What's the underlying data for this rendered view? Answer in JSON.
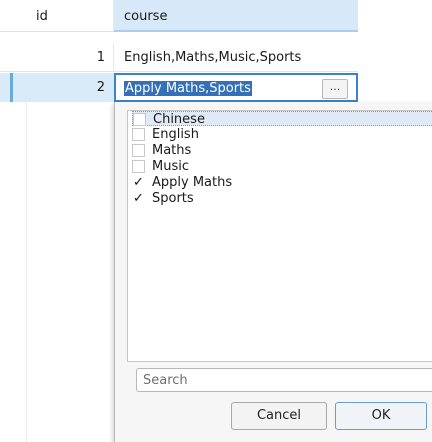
{
  "table": {
    "columns": [
      "id",
      "course"
    ],
    "rows": [
      {
        "id": "1",
        "course": "English,Maths,Music,Sports"
      },
      {
        "id": "2",
        "course": "Apply Maths,Sports"
      }
    ]
  },
  "editor": {
    "ellipsis_label": "..."
  },
  "picker": {
    "items": [
      {
        "label": "Chinese",
        "checked": false
      },
      {
        "label": "English",
        "checked": false
      },
      {
        "label": "Maths",
        "checked": false
      },
      {
        "label": "Music",
        "checked": false
      },
      {
        "label": "Apply Maths",
        "checked": true
      },
      {
        "label": "Sports",
        "checked": true
      }
    ],
    "check_mark": "✓",
    "search_placeholder": "Search",
    "cancel_label": "Cancel",
    "ok_label": "OK"
  }
}
